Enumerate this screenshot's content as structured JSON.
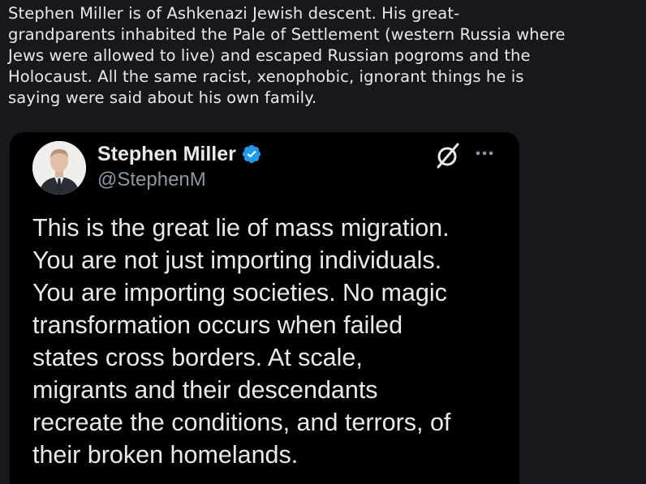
{
  "post": {
    "text_lines": [
      "Stephen Miller is of Ashkenazi Jewish descent. His great-",
      "grandparents inhabited the Pale of Settlement (western Russia where",
      "Jews were allowed to live) and escaped Russian pogroms and the",
      "Holocaust. All the same racist, xenophobic, ignorant things he is",
      "saying were said about his own family."
    ]
  },
  "embedded_tweet": {
    "display_name": "Stephen Miller",
    "handle": "@StephenM",
    "verified_color": "#1d9bf0",
    "body_lines": [
      "This is the great lie of mass migration.",
      "You are not just importing individuals.",
      "You are importing societies. No magic",
      "transformation occurs when failed",
      "states cross borders. At scale,",
      "migrants and their descendants",
      "recreate the conditions, and terrors, of",
      "their broken homelands."
    ],
    "icons": [
      "avatar",
      "verified-badge-icon",
      "grok-icon",
      "more-options-icon"
    ]
  },
  "colors": {
    "page_background": "#16181d",
    "card_background": "#000000",
    "primary_text": "#e7e9ea",
    "secondary_text": "#8b98a5"
  }
}
